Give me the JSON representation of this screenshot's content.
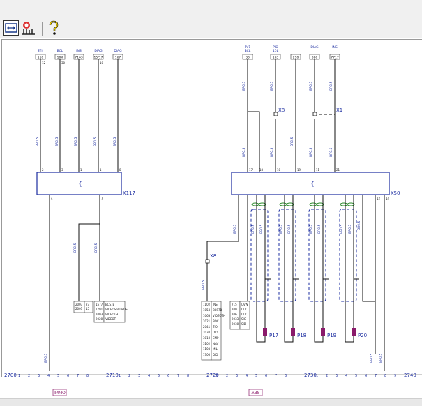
{
  "toolbar": {
    "buttons": [
      {
        "name": "fit-width-button",
        "icon": "fit-width-icon"
      },
      {
        "name": "component-locator-button",
        "icon": "component-locator-icon"
      },
      {
        "name": "help-button",
        "icon": "help-icon"
      }
    ]
  },
  "diagram": {
    "left_connector": {
      "top_labels": [
        "ST4",
        "BCL",
        "INS",
        "DIAG",
        "DIAG"
      ],
      "top_boxes": [
        "110",
        "10K",
        "7163",
        "15/17",
        "167"
      ],
      "pins_top": [
        "12",
        "30",
        "",
        "10",
        ""
      ],
      "wire_labels": [
        "BR0.5",
        "BR0.5",
        "BR0.5",
        "BR0.5",
        "BR0.5"
      ],
      "module_pins": [
        "2",
        "3",
        "1",
        "1",
        "8"
      ],
      "module_name": "K117",
      "lower_wire_labels": [
        "BR0.5",
        "BR0.5"
      ],
      "bottom_pins": [
        "4",
        "7"
      ],
      "terminal_table_left": [
        "2003",
        "2003"
      ],
      "terminal_table_mid": [
        "27",
        "15"
      ],
      "terminal_table_right_codes": [
        "1577",
        "1791",
        "1003",
        "2020"
      ],
      "terminal_table_right_text": [
        "BCS7B",
        "VIDEOS-VIDEOS",
        "VIDEOTH",
        "VIDEOT"
      ],
      "bottom_wire_label": "BR0.5"
    },
    "right_connector": {
      "top_labels": [
        "PV1",
        "PIO",
        "DIAG",
        "INS"
      ],
      "top_sublabels": [
        "BCL",
        "15L",
        "",
        ""
      ],
      "top_boxes": [
        "30",
        "163",
        "210",
        "386",
        "7717"
      ],
      "connector_x8": "X8",
      "connector_x1": "X1",
      "module_pins": [
        "17",
        "18",
        "10",
        "19",
        "11",
        "21"
      ],
      "module_name": "K50",
      "x8_lower": "X8",
      "table_codes": [
        "1102",
        "1053",
        "1063",
        "2021",
        "2041",
        "2030",
        "3010",
        "3102",
        "1103",
        "1700"
      ],
      "table_text": [
        "INS",
        "BCS7B",
        "VIDEOTH",
        "BOC",
        "TIO",
        "DIO",
        "EMP",
        "NAV",
        "MIL",
        "DIO"
      ],
      "table2_codes": [
        "715",
        "700",
        "706",
        "2033",
        "2030"
      ],
      "table2_text": [
        "UVW",
        "CLC",
        "CLC",
        "SIC",
        "SIB"
      ],
      "sensors": [
        "P17",
        "P18",
        "P19",
        "P20"
      ],
      "wire_labels_vertical": [
        "BR0.5",
        "BR0.5",
        "BR0.5",
        "BR0.5",
        "BR0.5",
        "BR0.5",
        "BR0.5",
        "BR0.5",
        "BR0.5"
      ],
      "right_side_pins": [
        "12",
        "14"
      ]
    },
    "bus": {
      "start_label": "2700",
      "ticks": [
        "1",
        "2",
        "3",
        "4",
        "5",
        "6",
        "7",
        "8",
        "9"
      ],
      "marks": [
        "2710",
        "2720",
        "2730",
        "2740"
      ]
    },
    "section_tags": [
      "IMMO",
      "ABS"
    ]
  }
}
